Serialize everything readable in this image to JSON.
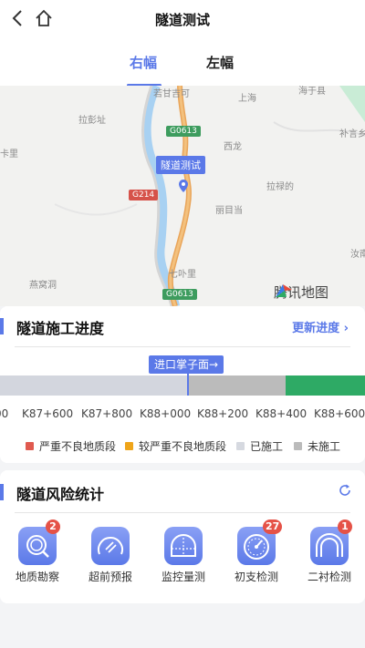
{
  "navbar": {
    "title": "隧道测试"
  },
  "tabs": [
    {
      "label": "右幅",
      "active": true
    },
    {
      "label": "左幅",
      "active": false
    }
  ],
  "map": {
    "labels": [
      "若甘吉可",
      "上海",
      "海于县",
      "拉彭址",
      "补言乡",
      "西龙",
      "卡里",
      "拉禄的",
      "丽目当",
      "汝南",
      "七卟里",
      "燕窝洞"
    ],
    "road_badges": [
      "G0613",
      "G214",
      "G0613"
    ],
    "marker_label": "隧道测试",
    "attribution": "腾讯地图"
  },
  "progress": {
    "title": "隧道施工进度",
    "update_link": "更新进度",
    "face_label": "进口掌子面→",
    "ticks": [
      "00",
      "K87+600",
      "K87+800",
      "K88+000",
      "K88+200",
      "K88+400",
      "K88+600"
    ],
    "legend": [
      {
        "label": "严重不良地质段",
        "color": "#e05a4f"
      },
      {
        "label": "较严重不良地质段",
        "color": "#efa51a"
      },
      {
        "label": "已施工",
        "color": "#d6d9e0"
      },
      {
        "label": "未施工",
        "color": "#bbbbbb"
      }
    ],
    "segment_colors": {
      "done": "#d3d6de",
      "pending": "#bbbbbb",
      "end": "#2eaa65"
    }
  },
  "risk": {
    "title": "隧道风险统计",
    "items": [
      {
        "label": "地质勘察",
        "badge": "2",
        "icon": "magnifier-icon"
      },
      {
        "label": "超前预报",
        "badge": "",
        "icon": "forecast-dial-icon"
      },
      {
        "label": "监控量测",
        "badge": "",
        "icon": "tunnel-monitor-icon"
      },
      {
        "label": "初支检测",
        "badge": "27",
        "icon": "gauge-icon"
      },
      {
        "label": "二衬检测",
        "badge": "1",
        "icon": "tunnel-arch-icon"
      }
    ]
  },
  "colors": {
    "accent": "#5b79e8",
    "badge": "#e55247"
  }
}
